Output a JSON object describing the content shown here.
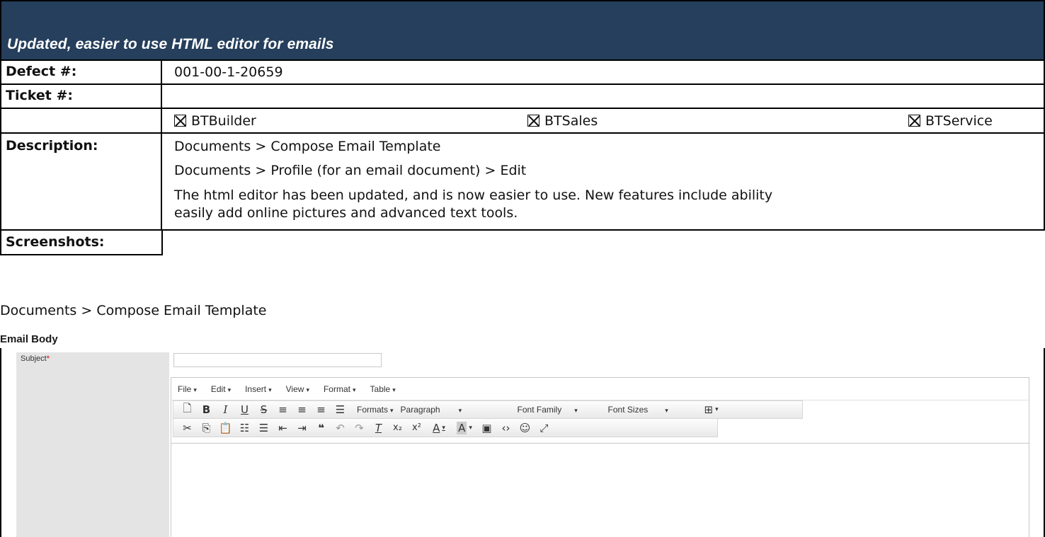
{
  "header": {
    "title": "Updated, easier to use HTML editor for emails"
  },
  "fields": {
    "defect_label": "Defect #:",
    "defect_value": "001-00-1-20659",
    "ticket_label": "Ticket #:",
    "ticket_value": "",
    "products": [
      {
        "label": "BTBuilder",
        "checked": true
      },
      {
        "label": "BTSales",
        "checked": true
      },
      {
        "label": "BTService",
        "checked": true
      }
    ],
    "description_label": "Description:",
    "description_lines": [
      "Documents > Compose Email Template",
      "Documents > Profile (for an email document) > Edit",
      "The html editor has been updated, and is now easier to use. New features include ability",
      "easily add online pictures and advanced text tools."
    ],
    "screenshots_label": "Screenshots:"
  },
  "screenshot": {
    "heading": "Documents > Compose Email Template",
    "section_title": "Email Body",
    "subject_label": "Subject",
    "subject_required_mark": "*",
    "menu": [
      "File",
      "Edit",
      "Insert",
      "View",
      "Format",
      "Table"
    ],
    "toolbar": {
      "formats": "Formats",
      "block": "Paragraph",
      "font_family": "Font Family",
      "font_sizes": "Font Sizes"
    }
  },
  "colors": {
    "header_bg": "#253f5c",
    "header_text": "#ffffff",
    "required": "#dd0000",
    "label_bg": "#e4e4e4"
  }
}
